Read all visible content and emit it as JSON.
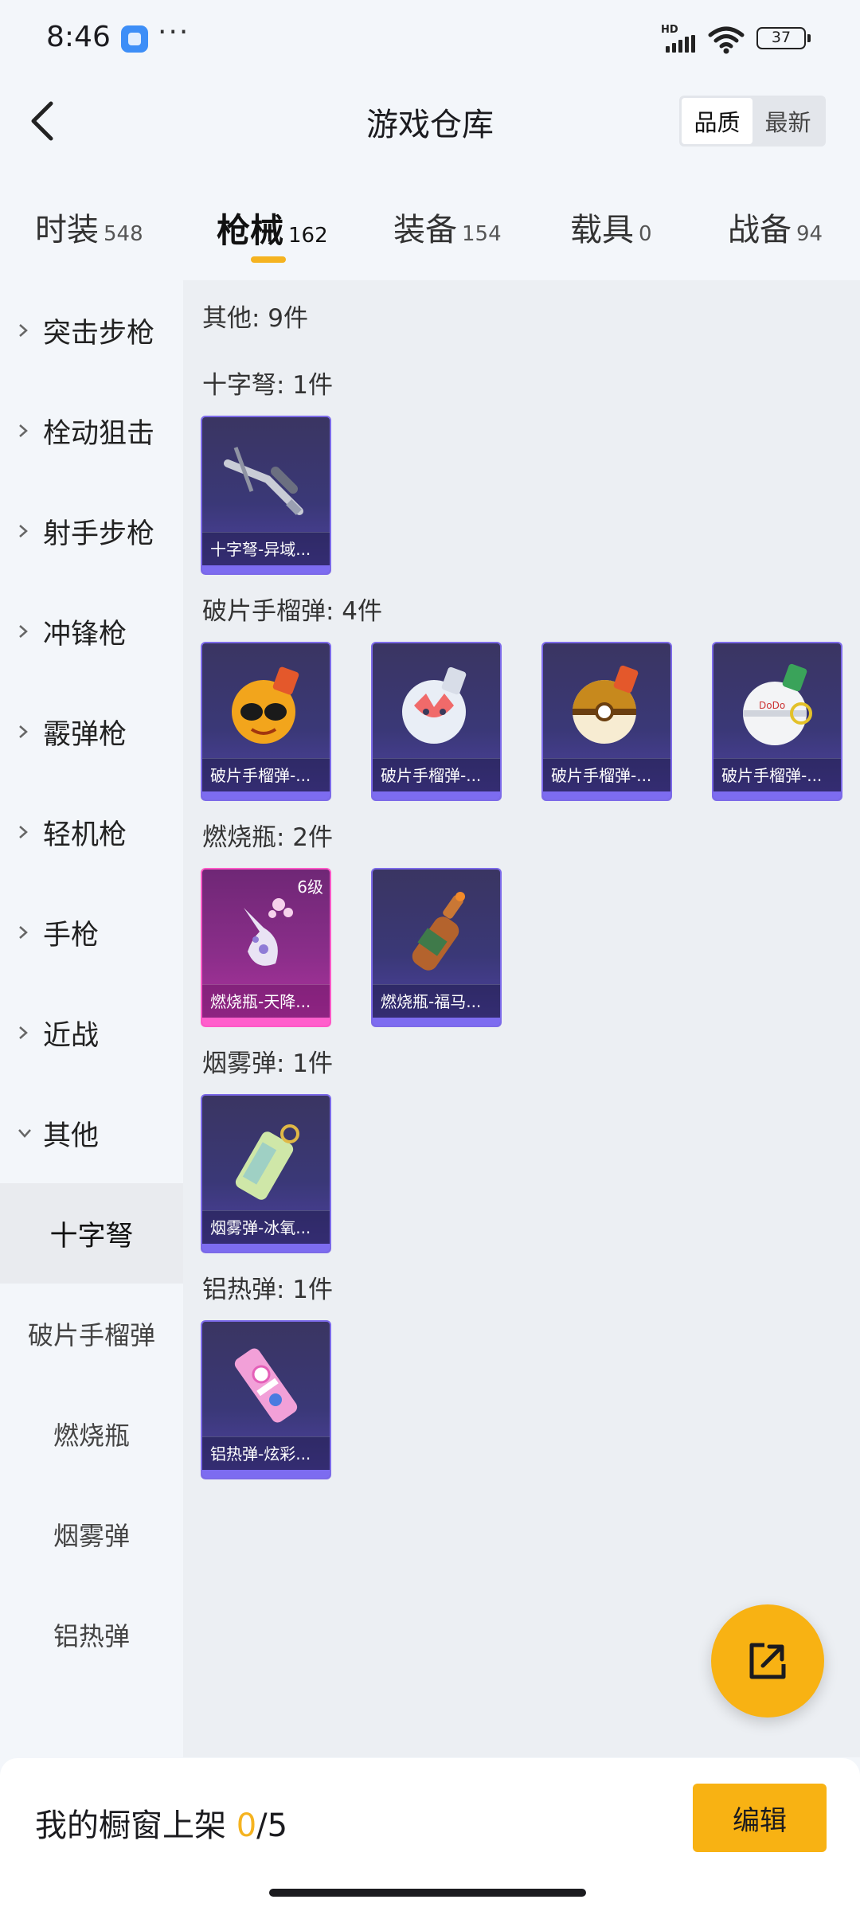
{
  "status": {
    "time": "8:46",
    "dots": "···",
    "network": "HD",
    "battery": "37"
  },
  "header": {
    "title": "游戏仓库",
    "sort_options": [
      "品质",
      "最新"
    ],
    "active_sort": "品质"
  },
  "tabs": [
    {
      "label": "时装",
      "count": "548"
    },
    {
      "label": "枪械",
      "count": "162"
    },
    {
      "label": "装备",
      "count": "154"
    },
    {
      "label": "载具",
      "count": "0"
    },
    {
      "label": "战备",
      "count": "94"
    }
  ],
  "active_tab": "枪械",
  "sidebar": {
    "categories": [
      "突击步枪",
      "栓动狙击",
      "射手步枪",
      "冲锋枪",
      "霰弹枪",
      "轻机枪",
      "手枪",
      "近战",
      "其他"
    ],
    "expanded": "其他",
    "subcategories": [
      "十字弩",
      "破片手榴弹",
      "燃烧瓶",
      "烟雾弹",
      "铝热弹"
    ],
    "active_sub": "十字弩"
  },
  "content": {
    "summary": "其他: 9件",
    "sections": [
      {
        "title": "十字弩: 1件",
        "items": [
          {
            "name": "十字弩-异域...",
            "art": "crossbow-icon"
          }
        ]
      },
      {
        "title": "破片手榴弹: 4件",
        "items": [
          {
            "name": "破片手榴弹-...",
            "art": "grenade-sunglasses-icon"
          },
          {
            "name": "破片手榴弹-...",
            "art": "grenade-fox-icon"
          },
          {
            "name": "破片手榴弹-...",
            "art": "grenade-pokeball-icon"
          },
          {
            "name": "破片手榴弹-...",
            "art": "grenade-white-icon"
          }
        ]
      },
      {
        "title": "燃烧瓶: 2件",
        "items": [
          {
            "name": "燃烧瓶-天降...",
            "art": "molotov-floral-icon",
            "level": "6级",
            "rarity": "pink"
          },
          {
            "name": "燃烧瓶-福马...",
            "art": "molotov-bottle-icon"
          }
        ]
      },
      {
        "title": "烟雾弹: 1件",
        "items": [
          {
            "name": "烟雾弹-冰氧...",
            "art": "smoke-canister-icon"
          }
        ]
      },
      {
        "title": "铝热弹: 1件",
        "items": [
          {
            "name": "铝热弹-炫彩...",
            "art": "thermite-candy-icon"
          }
        ]
      }
    ]
  },
  "bottom": {
    "showcase_label": "我的橱窗上架 ",
    "current": "0",
    "sep_max": "/5",
    "edit_label": "编辑"
  },
  "colors": {
    "accent": "#f8b213",
    "card_purple": "#3a3877",
    "card_pink": "#b0339f"
  }
}
